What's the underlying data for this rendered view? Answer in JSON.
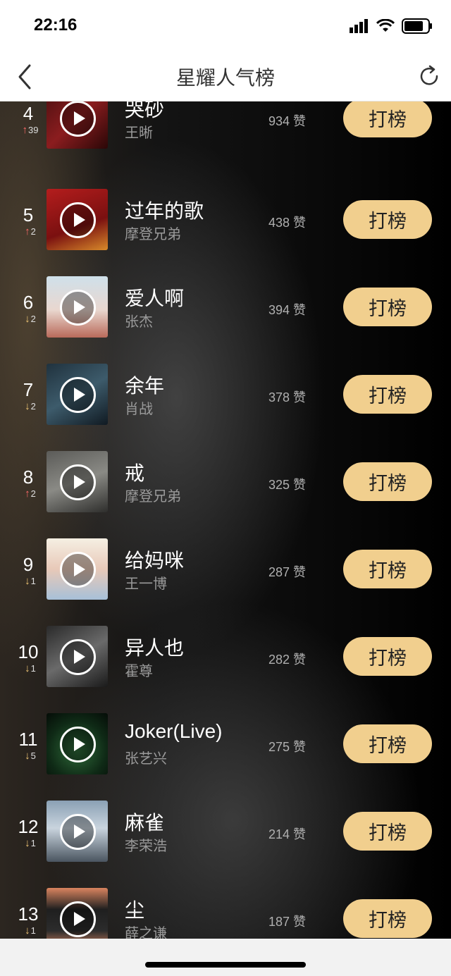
{
  "status_bar": {
    "time": "22:16"
  },
  "nav": {
    "title": "星耀人气榜",
    "back_icon": "chevron-left-icon",
    "refresh_icon": "refresh-icon"
  },
  "colors": {
    "vote_button": "#f1cf8e",
    "trend_up": "#ff6a6a",
    "trend_down": "#f1c776"
  },
  "list": [
    {
      "rank": "4",
      "trend_dir": "up",
      "trend_val": "39",
      "song": "哭砂",
      "artist": "王晰",
      "likes": "934 赞",
      "button": "打榜"
    },
    {
      "rank": "5",
      "trend_dir": "up",
      "trend_val": "2",
      "song": "过年的歌",
      "artist": "摩登兄弟",
      "likes": "438 赞",
      "button": "打榜"
    },
    {
      "rank": "6",
      "trend_dir": "down",
      "trend_val": "2",
      "song": "爱人啊",
      "artist": "张杰",
      "likes": "394 赞",
      "button": "打榜"
    },
    {
      "rank": "7",
      "trend_dir": "down",
      "trend_val": "2",
      "song": "余年",
      "artist": "肖战",
      "likes": "378 赞",
      "button": "打榜"
    },
    {
      "rank": "8",
      "trend_dir": "up",
      "trend_val": "2",
      "song": "戒",
      "artist": "摩登兄弟",
      "likes": "325 赞",
      "button": "打榜"
    },
    {
      "rank": "9",
      "trend_dir": "down",
      "trend_val": "1",
      "song": "给妈咪",
      "artist": "王一博",
      "likes": "287 赞",
      "button": "打榜"
    },
    {
      "rank": "10",
      "trend_dir": "down",
      "trend_val": "1",
      "song": "异人也",
      "artist": "霍尊",
      "likes": "282 赞",
      "button": "打榜"
    },
    {
      "rank": "11",
      "trend_dir": "down",
      "trend_val": "5",
      "song": "Joker(Live)",
      "artist": "张艺兴",
      "likes": "275 赞",
      "button": "打榜"
    },
    {
      "rank": "12",
      "trend_dir": "down",
      "trend_val": "1",
      "song": "麻雀",
      "artist": "李荣浩",
      "likes": "214 赞",
      "button": "打榜"
    },
    {
      "rank": "13",
      "trend_dir": "down",
      "trend_val": "1",
      "song": "尘",
      "artist": "薛之谦",
      "likes": "187 赞",
      "button": "打榜"
    }
  ]
}
